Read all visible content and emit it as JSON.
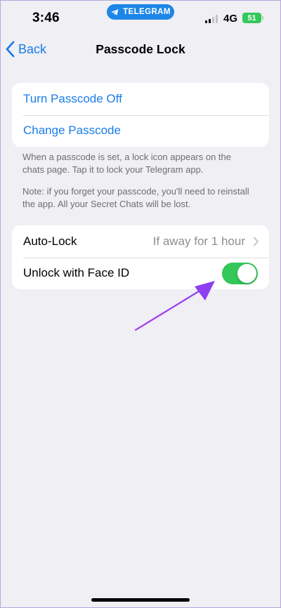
{
  "status_bar": {
    "time": "3:46",
    "app_pill": "TELEGRAM",
    "network": "4G",
    "battery": "51",
    "accent_color": "#1d86e6"
  },
  "nav": {
    "back_label": "Back",
    "title": "Passcode Lock"
  },
  "passcode_group": {
    "items": [
      {
        "label": "Turn Passcode Off"
      },
      {
        "label": "Change Passcode"
      }
    ]
  },
  "footer": {
    "line1": "When a passcode is set, a lock icon appears on the chats page. Tap it to lock your Telegram app.",
    "line2": "Note: if you forget your passcode, you'll need to reinstall the app. All your Secret Chats will be lost."
  },
  "settings_group": {
    "auto_lock": {
      "label": "Auto-Lock",
      "value": "If away for 1 hour"
    },
    "face_id": {
      "label": "Unlock with Face ID",
      "enabled": true
    }
  },
  "colors": {
    "link": "#1a7de8",
    "toggle_on": "#34c759",
    "annotation_arrow": "#9b3ff0"
  },
  "icons": [
    "telegram-logo-icon",
    "signal-icon",
    "battery-icon",
    "chevron-left-icon",
    "chevron-right-icon"
  ]
}
